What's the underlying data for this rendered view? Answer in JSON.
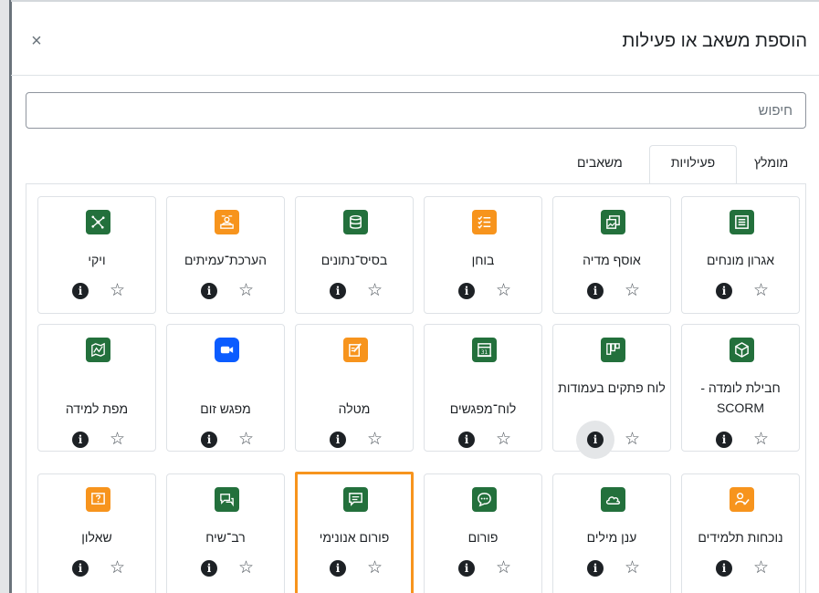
{
  "modal": {
    "title": "הוספת משאב או פעילות",
    "close_symbol": "×"
  },
  "search": {
    "placeholder": "חיפוש",
    "value": ""
  },
  "tabs": [
    {
      "label": "מומלץ",
      "active": false
    },
    {
      "label": "פעילויות",
      "active": true
    },
    {
      "label": "משאבים",
      "active": false
    }
  ],
  "activities": [
    {
      "label": "אגרון מונחים",
      "icon": "glossary-icon",
      "color": "#23703c"
    },
    {
      "label": "אוסף מדיה",
      "icon": "media-collection-icon",
      "color": "#23703c"
    },
    {
      "label": "בוחן",
      "icon": "quiz-icon",
      "color": "#f7941d"
    },
    {
      "label": "בסיס־נתונים",
      "icon": "database-icon",
      "color": "#23703c"
    },
    {
      "label": "הערכת־עמיתים",
      "icon": "workshop-icon",
      "color": "#f7941d"
    },
    {
      "label": "ויקי",
      "icon": "wiki-icon",
      "color": "#23703c"
    },
    {
      "label": "חבילת לומדה - SCORM",
      "icon": "scorm-package-icon",
      "color": "#23703c"
    },
    {
      "label": "לוח פתקים בעמודות",
      "icon": "kanban-board-icon",
      "color": "#23703c"
    },
    {
      "label": "לוח־מפגשים",
      "icon": "scheduler-icon",
      "color": "#23703c"
    },
    {
      "label": "מטלה",
      "icon": "assignment-icon",
      "color": "#f7941d"
    },
    {
      "label": "מפגש זום",
      "icon": "zoom-icon",
      "color": "#0b5cff"
    },
    {
      "label": "מפת למידה",
      "icon": "learning-map-icon",
      "color": "#23703c"
    },
    {
      "label": "נוכחות תלמידים",
      "icon": "attendance-icon",
      "color": "#f7941d"
    },
    {
      "label": "ענן מילים",
      "icon": "word-cloud-icon",
      "color": "#23703c"
    },
    {
      "label": "פורום",
      "icon": "forum-icon",
      "color": "#23703c"
    },
    {
      "label": "פורום אנונימי",
      "icon": "anonymous-forum-icon",
      "color": "#23703c",
      "highlighted": true
    },
    {
      "label": "רב־שיח",
      "icon": "chat-icon",
      "color": "#23703c"
    },
    {
      "label": "שאלון",
      "icon": "questionnaire-icon",
      "color": "#f7941d"
    }
  ],
  "card_actions": {
    "info_symbol": "i",
    "star_symbol": "☆"
  },
  "colors": {
    "highlight": "#f7941d",
    "green": "#23703c",
    "orange": "#f7941d",
    "zoom_blue": "#0b5cff"
  }
}
